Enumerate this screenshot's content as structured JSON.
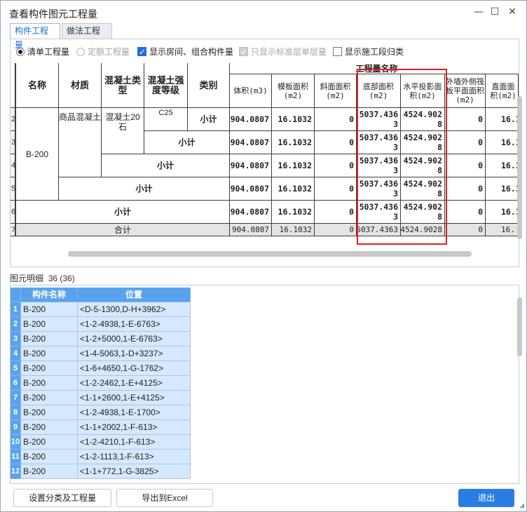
{
  "window": {
    "title": "查看构件图元工程量"
  },
  "tabs": [
    {
      "label": "构件工程量"
    },
    {
      "label": "做法工程量"
    }
  ],
  "options": {
    "radio_list": "清单工程量",
    "radio_quota": "定额工程量",
    "chk_rooms": "显示房间、组合构件量",
    "chk_std_floor": "只显示标准层单层量",
    "chk_stage": "显示施工段归类"
  },
  "grid": {
    "headers": {
      "name": "名称",
      "material": "材质",
      "concrete_type": "混凝土类型",
      "concrete_grade": "混凝土强度等级",
      "category": "类别",
      "group": "工程量名称",
      "volume": "体积(m3)",
      "formwork": "模板面积(m2)",
      "slope": "斜面面积(m2)",
      "bottom": "底部面积(m2)",
      "projection": "水平投影面积(m2)",
      "outer_wall": "外墙外侧筏板平面面积(m2)",
      "straight": "直面面积(m2)"
    },
    "row_numbers": [
      "2",
      "3",
      "4",
      "5",
      "6",
      "7"
    ],
    "name_value": "B-200",
    "material_value": "商品混凝土",
    "concrete_type_value": "混凝土20石",
    "grade_value": "C25",
    "subtotal_label": "小计",
    "total_label": "合计",
    "volume": "904.0807",
    "formwork": "16.1032",
    "slope": "0",
    "bottom": "5037.4363",
    "projection": "4524.9028",
    "outer_wall": "0",
    "straight": "16.1",
    "total": {
      "volume": "904.0807",
      "formwork": "16.1032",
      "slope": "0",
      "bottom": "5037.4363",
      "projection": "4524.9028",
      "outer_wall": "0",
      "straight": "16."
    }
  },
  "detail": {
    "title": "图元明细",
    "count": "36 (36)",
    "headers": {
      "name": "构件名称",
      "position": "位置"
    },
    "rows": [
      {
        "idx": "1",
        "name": "B-200",
        "pos": "<D-5-1300,D-H+3962>"
      },
      {
        "idx": "2",
        "name": "B-200",
        "pos": "<1-2-4938,1-E-6763>"
      },
      {
        "idx": "3",
        "name": "B-200",
        "pos": "<1-2+5000,1-E-6763>"
      },
      {
        "idx": "4",
        "name": "B-200",
        "pos": "<1-4-5063,1-D+3237>"
      },
      {
        "idx": "5",
        "name": "B-200",
        "pos": "<1-6+4650,1-G-1762>"
      },
      {
        "idx": "6",
        "name": "B-200",
        "pos": "<1-2-2462,1-E+4125>"
      },
      {
        "idx": "7",
        "name": "B-200",
        "pos": "<1-1+2600,1-E+4125>"
      },
      {
        "idx": "8",
        "name": "B-200",
        "pos": "<1-2-4938,1-E-1700>"
      },
      {
        "idx": "9",
        "name": "B-200",
        "pos": "<1-1+2002,1-F-613>"
      },
      {
        "idx": "10",
        "name": "B-200",
        "pos": "<1-2-4210,1-F-613>"
      },
      {
        "idx": "11",
        "name": "B-200",
        "pos": "<1-2-1113,1-F-613>"
      },
      {
        "idx": "12",
        "name": "B-200",
        "pos": "<1-1+772,1-G-3825>"
      }
    ]
  },
  "buttons": {
    "settings": "设置分类及工程量",
    "export": "导出到Excel",
    "exit": "退出"
  }
}
